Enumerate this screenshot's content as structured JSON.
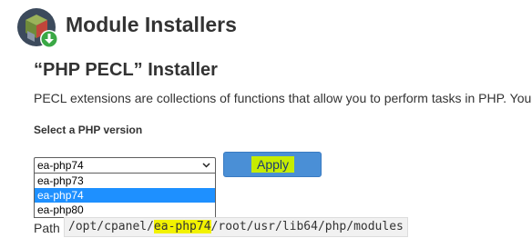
{
  "header": {
    "title": "Module Installers",
    "logo_icon": "module-cube-download-icon"
  },
  "installer": {
    "title": "“PHP PECL” Installer",
    "description": "PECL extensions are collections of functions that allow you to perform tasks in PHP. You"
  },
  "version_select": {
    "label": "Select a PHP version",
    "value": "ea-php74",
    "options": [
      "ea-php73",
      "ea-php74",
      "ea-php80"
    ],
    "selected_index": 1
  },
  "apply_button": {
    "label": "Apply"
  },
  "path": {
    "label": "Path",
    "prefix": "/opt/cpanel/",
    "highlight": "ea-php74",
    "suffix": "/root/usr/lib64/php/modules"
  },
  "colors": {
    "button_bg": "#4a8fd6",
    "highlight": "#c6ec00",
    "selected_option": "#1e90ff",
    "path_highlight": "#f2f200"
  }
}
